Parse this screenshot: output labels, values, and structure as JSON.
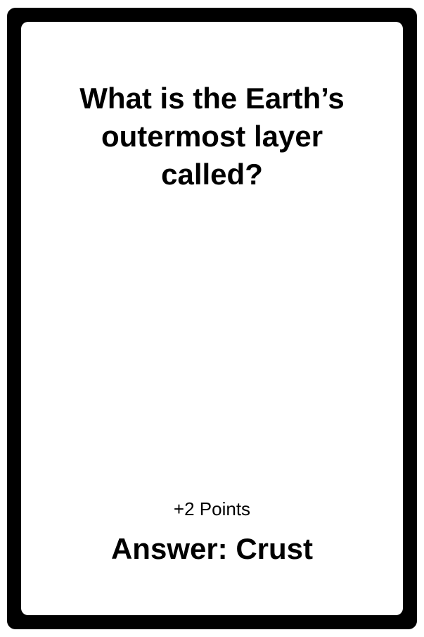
{
  "card": {
    "question": "What is the Earth’s outermost layer called?",
    "points": "+2 Points",
    "answer": "Answer: Crust"
  },
  "colors": {
    "frame": "#000000",
    "card_background": "#ffffff",
    "text": "#000000"
  }
}
